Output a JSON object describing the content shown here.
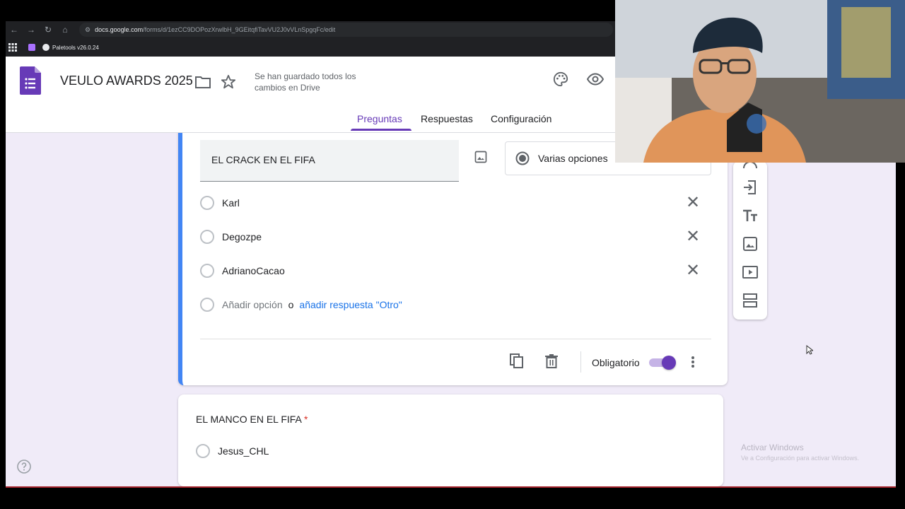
{
  "browser": {
    "url_host": "docs.google.com",
    "url_path": "/forms/d/1ezCC9DOPozXrwlbH_9GEitqfiTavVU2J0vVLnSpgqFc/edit",
    "bookmark_label": "Paletools v26.0.24"
  },
  "header": {
    "form_title": "VEULO AWARDS 2025",
    "saved_status": "Se han guardado todos los cambios en Drive"
  },
  "tabs": [
    {
      "label": "Preguntas"
    },
    {
      "label": "Respuestas"
    },
    {
      "label": "Configuración"
    }
  ],
  "question1": {
    "title": "EL CRACK EN EL FIFA",
    "type_label": "Varias opciones",
    "options": [
      "Karl",
      "Degozpe",
      "AdrianoCacao"
    ],
    "add_option": "Añadir opción",
    "or_text": "o",
    "add_other": "añadir respuesta \"Otro\"",
    "required_label": "Obligatorio"
  },
  "question2": {
    "title": "EL MANCO EN EL FIFA",
    "required_mark": "*",
    "options": [
      "Jesus_CHL"
    ]
  },
  "watermark": {
    "line1": "Activar Windows",
    "line2": "Ve a Configuración para activar Windows."
  },
  "colors": {
    "accent": "#673ab7",
    "focus_bar": "#4285f4",
    "background": "#f0ebf8"
  }
}
